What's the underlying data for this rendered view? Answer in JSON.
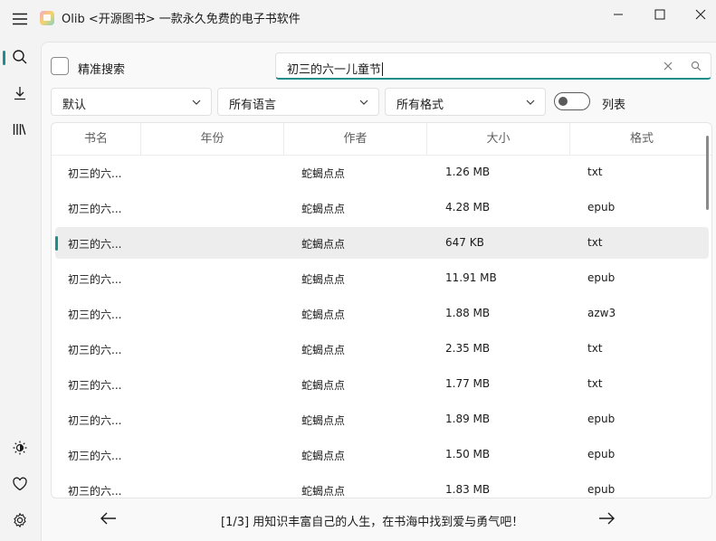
{
  "window": {
    "title": "Olib <开源图书> 一款永久免费的电子书软件",
    "accent": "#1f8e8a"
  },
  "sidebar": {
    "items": [
      {
        "icon": "hamburger-menu-icon"
      },
      {
        "icon": "search-icon"
      },
      {
        "icon": "download-icon"
      },
      {
        "icon": "library-icon"
      },
      {
        "icon": "theme-icon"
      },
      {
        "icon": "heart-icon"
      },
      {
        "icon": "settings-icon"
      }
    ]
  },
  "search": {
    "exact_label": "精准搜索",
    "query": "初三的六一儿童节"
  },
  "filters": {
    "sort": "默认",
    "language": "所有语言",
    "format": "所有格式",
    "list_toggle_label": "列表"
  },
  "table": {
    "columns": [
      "书名",
      "年份",
      "作者",
      "大小",
      "格式"
    ],
    "rows": [
      {
        "title": "初三的六...",
        "year": "",
        "author": "蛇蝎点点",
        "size": "1.26 MB",
        "format": "txt"
      },
      {
        "title": "初三的六...",
        "year": "",
        "author": "蛇蝎点点",
        "size": "4.28 MB",
        "format": "epub"
      },
      {
        "title": "初三的六...",
        "year": "",
        "author": "蛇蝎点点",
        "size": "647 KB",
        "format": "txt"
      },
      {
        "title": "初三的六...",
        "year": "",
        "author": "蛇蝎点点",
        "size": "11.91 MB",
        "format": "epub"
      },
      {
        "title": "初三的六...",
        "year": "",
        "author": "蛇蝎点点",
        "size": "1.88 MB",
        "format": "azw3"
      },
      {
        "title": "初三的六...",
        "year": "",
        "author": "蛇蝎点点",
        "size": "2.35 MB",
        "format": "txt"
      },
      {
        "title": "初三的六...",
        "year": "",
        "author": "蛇蝎点点",
        "size": "1.77 MB",
        "format": "txt"
      },
      {
        "title": "初三的六...",
        "year": "",
        "author": "蛇蝎点点",
        "size": "1.89 MB",
        "format": "epub"
      },
      {
        "title": "初三的六...",
        "year": "",
        "author": "蛇蝎点点",
        "size": "1.50 MB",
        "format": "epub"
      },
      {
        "title": "初三的六...",
        "year": "",
        "author": "蛇蝎点点",
        "size": "1.83 MB",
        "format": "epub"
      }
    ]
  },
  "footer": {
    "page_text": "[1/3] 用知识丰富自己的人生，在书海中找到爱与勇气吧！"
  }
}
